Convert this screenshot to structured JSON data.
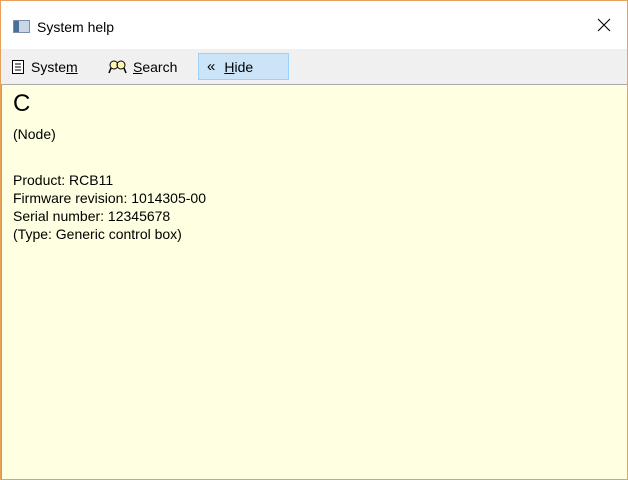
{
  "window": {
    "title": "System help"
  },
  "toolbar": {
    "system": {
      "label_pre": "Syste",
      "label_u": "m",
      "label_post": ""
    },
    "search": {
      "label_pre": "",
      "label_u": "S",
      "label_post": "earch"
    },
    "hide": {
      "chevron": "«",
      "label_pre": "",
      "label_u": "H",
      "label_post": "ide"
    }
  },
  "content": {
    "node_name": "C",
    "node_type": "(Node)",
    "lines": [
      "Product: RCB11",
      "Firmware revision: 1014305-00",
      "Serial number: 12345678",
      "(Type: Generic control box)"
    ]
  },
  "icons": {
    "app": "window-icon",
    "close": "close-icon",
    "system": "document-list-icon",
    "search": "search-icon",
    "hide": "chevron-double-left-icon"
  },
  "colors": {
    "content_bg": "#ffffe1",
    "hide_active_bg": "#cce4f7",
    "toolbar_bg": "#f0f0f0",
    "window_border": "#e8a15a"
  }
}
